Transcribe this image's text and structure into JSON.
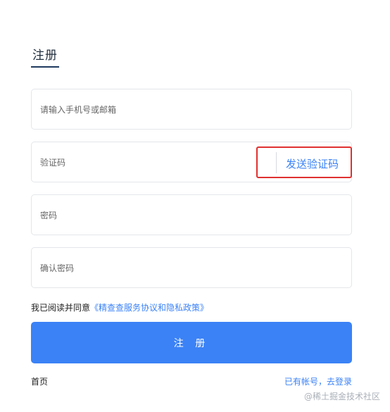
{
  "page": {
    "title": "注册"
  },
  "form": {
    "account_placeholder": "请输入手机号或邮箱",
    "code_placeholder": "验证码",
    "send_code_label": "发送验证码",
    "password_placeholder": "密码",
    "confirm_password_placeholder": "确认密码"
  },
  "agreement": {
    "prefix": "我已阅读并同意",
    "link": "《精查查服务协议和隐私政策》"
  },
  "actions": {
    "register_label": "注 册",
    "home_label": "首页",
    "login_label": "已有帐号，去登录"
  },
  "watermark": "@稀土掘金技术社区",
  "colors": {
    "accent": "#3b82f6",
    "highlight_border": "#e03030"
  }
}
